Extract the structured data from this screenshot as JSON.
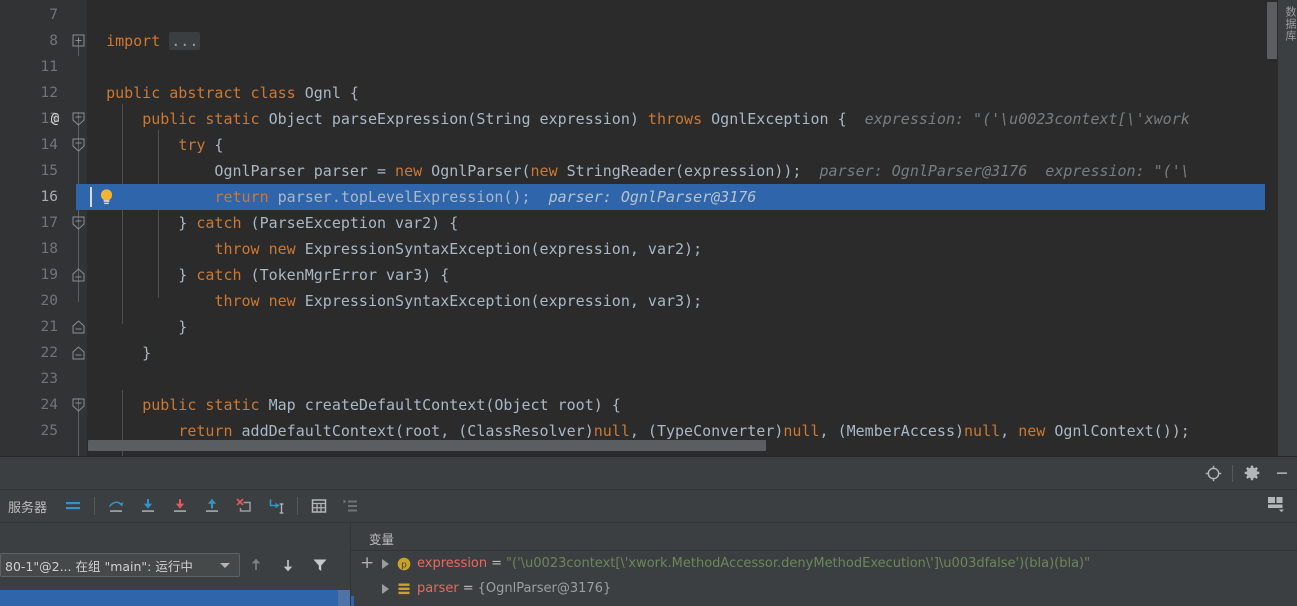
{
  "editor": {
    "lines": [
      {
        "num": "7",
        "at": "",
        "fold": "",
        "code_html": ""
      },
      {
        "num": "8",
        "at": "",
        "fold": "plus",
        "code_html": "  <span class='kw'>import</span> <span class='fold-placeholder'>...</span>"
      },
      {
        "num": "11",
        "at": "",
        "fold": "",
        "code_html": ""
      },
      {
        "num": "12",
        "at": "",
        "fold": "",
        "code_html": "  <span class='kw'>public abstract class</span> Ognl {"
      },
      {
        "num": "13",
        "at": "@",
        "fold": "minus",
        "code_html": "      <span class='kw'>public static</span> Object parseExpression(String expression) <span class='kw'>throws</span> OgnlException {  <span class='hint'>expression: \"('\\u0023context[\\'xwork</span>"
      },
      {
        "num": "14",
        "at": "",
        "fold": "minus",
        "code_html": "          <span class='kw'>try</span> {"
      },
      {
        "num": "15",
        "at": "",
        "fold": "",
        "code_html": "              OgnlParser parser = <span class='kw'>new</span> OgnlParser(<span class='kw'>new</span> StringReader(expression));  <span class='hint'>parser: OgnlParser@3176  expression: \"('\\</span>"
      },
      {
        "num": "16",
        "at": "",
        "fold": "",
        "code_html": "              <span class='kw'>return</span> parser.topLevelExpression();  <span class='hint'>parser: OgnlParser@3176</span>",
        "highlighted": true,
        "bulb": true
      },
      {
        "num": "17",
        "at": "",
        "fold": "minus",
        "code_html": "          } <span class='kw'>catch</span> (ParseException var2) {"
      },
      {
        "num": "18",
        "at": "",
        "fold": "",
        "code_html": "              <span class='kw'>throw new</span> ExpressionSyntaxException(expression, var2);"
      },
      {
        "num": "19",
        "at": "",
        "fold": "end",
        "code_html": "          } <span class='kw'>catch</span> (TokenMgrError var3) {"
      },
      {
        "num": "20",
        "at": "",
        "fold": "",
        "code_html": "              <span class='kw'>throw new</span> ExpressionSyntaxException(expression, var3);"
      },
      {
        "num": "21",
        "at": "",
        "fold": "end",
        "code_html": "          }"
      },
      {
        "num": "22",
        "at": "",
        "fold": "end",
        "code_html": "      }"
      },
      {
        "num": "23",
        "at": "",
        "fold": "",
        "code_html": ""
      },
      {
        "num": "24",
        "at": "",
        "fold": "minus",
        "code_html": "      <span class='kw'>public static</span> Map createDefaultContext(Object root) {"
      },
      {
        "num": "25",
        "at": "",
        "fold": "",
        "code_html": "          <span class='kw'>return</span> addDefaultContext(root, (ClassResolver)<span class='kw'>null</span>, (TypeConverter)<span class='kw'>null</span>, (MemberAccess)<span class='kw'>null</span>, <span class='kw'>new</span> OgnlContext());"
      }
    ],
    "right_tab_label": "数据库"
  },
  "debug": {
    "window_controls": [
      {
        "name": "settings-target-icon",
        "label": "target"
      },
      {
        "name": "gear-icon",
        "label": "settings"
      },
      {
        "name": "minimize-icon",
        "label": "minimize"
      }
    ],
    "toolbar_title": "服务器",
    "toolbar_buttons": [
      {
        "name": "show-execution-point-button",
        "icon": "lines"
      },
      {
        "name": "step-over-button",
        "icon": "step-over"
      },
      {
        "name": "step-into-button",
        "icon": "step-into"
      },
      {
        "name": "force-step-into-button",
        "icon": "force-step-into"
      },
      {
        "name": "step-out-button",
        "icon": "step-out"
      },
      {
        "name": "drop-frame-button",
        "icon": "drop-frame"
      },
      {
        "name": "run-to-cursor-button",
        "icon": "run-to-cursor"
      },
      {
        "name": "evaluate-expression-button",
        "icon": "calculator"
      },
      {
        "name": "trace-button",
        "icon": "trace"
      }
    ],
    "layout_button_label": "layout-settings",
    "frames": {
      "thread_selector_value": "80-1\"@2... 在组 \"main\": 运行中",
      "buttons": [
        {
          "name": "frames-up-button",
          "icon": "arrow-up"
        },
        {
          "name": "frames-down-button",
          "icon": "arrow-down"
        },
        {
          "name": "frames-filter-button",
          "icon": "filter"
        }
      ]
    },
    "variables": {
      "header": "变量",
      "add_label": "+",
      "rows": [
        {
          "icon": "parameter-icon",
          "name": "expression",
          "eq": "=",
          "value": "\"('\\u0023context[\\'xwork.MethodAccessor.denyMethodExecution\\']\\u003dfalse')(bla)(bla)\"",
          "value_kind": "string"
        },
        {
          "icon": "object-icon",
          "name": "parser",
          "eq": "=",
          "value": "{OgnlParser@3176}",
          "value_kind": "ref"
        }
      ]
    }
  },
  "colors": {
    "editor_bg": "#2b2b2b",
    "gutter_bg": "#313335",
    "panel_bg": "#3c3f41",
    "selection_blue": "#2f65ab",
    "keyword_orange": "#cc7832",
    "text_grey": "#a9b7c6",
    "hint_grey": "#787d80",
    "string_green": "#6a8759",
    "var_name_red": "#e8695f",
    "icon_blue": "#3592c4",
    "icon_red": "#db5c5c",
    "gold": "#c9a226"
  }
}
